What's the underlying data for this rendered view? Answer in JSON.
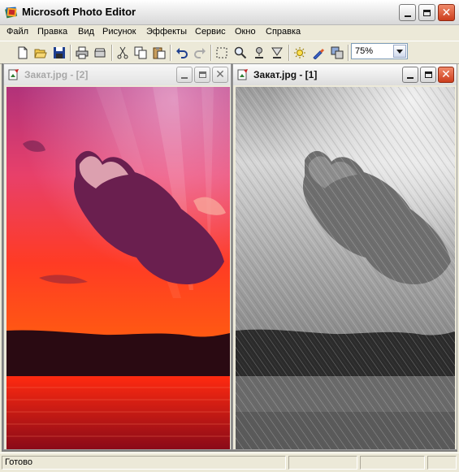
{
  "window": {
    "title": "Microsoft Photo Editor"
  },
  "menu": [
    "Файл",
    "Правка",
    "Вид",
    "Рисунок",
    "Эффекты",
    "Сервис",
    "Окно",
    "Справка"
  ],
  "toolbar": {
    "buttons": [
      "new-icon",
      "open-icon",
      "save-icon",
      "print-icon",
      "scan-icon",
      "cut-icon",
      "copy-icon",
      "paste-icon",
      "undo-icon",
      "redo-icon",
      "select-icon",
      "zoom-icon",
      "smudge-icon",
      "sharpen-icon",
      "sun-icon",
      "transparent-icon",
      "effects-icon"
    ],
    "zoom": {
      "value": "75%"
    }
  },
  "documents": [
    {
      "title": "Закат.jpg - [2]",
      "active": false,
      "effect": "color"
    },
    {
      "title": "Закат.jpg - [1]",
      "active": true,
      "effect": "grayscale chalk"
    }
  ],
  "status": {
    "text": "Готово"
  },
  "colors": {
    "titlebar": "#e6e6e6",
    "close": "#d9532f",
    "sky_top": "#b1327a",
    "sky_bottom": "#ff3b24",
    "water": "#ff1a1a"
  }
}
